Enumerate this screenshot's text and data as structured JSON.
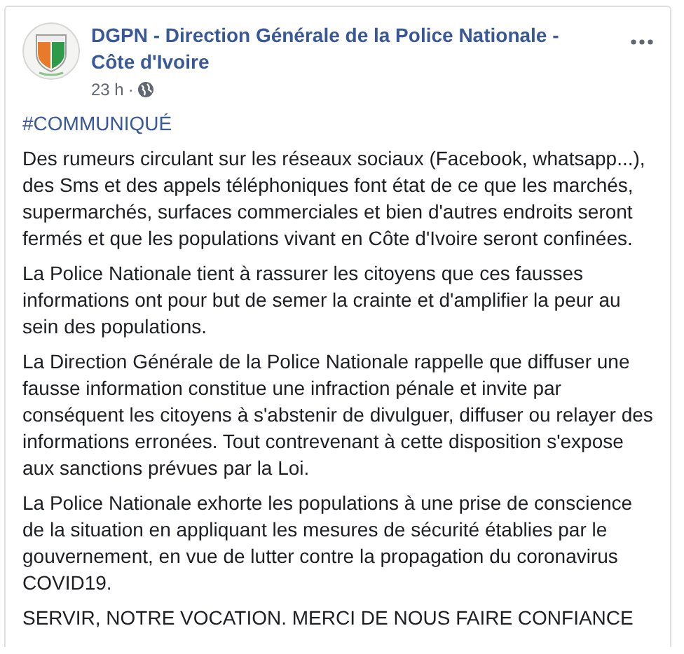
{
  "post": {
    "author": "DGPN - Direction Générale de la Police Nationale - Côte d'Ivoire",
    "time": "23 h",
    "separator": "·",
    "hashtag": "#COMMUNIQUÉ",
    "paragraphs": [
      "Des rumeurs circulant sur les réseaux sociaux (Facebook, whatsapp...), des Sms et des appels téléphoniques font état de ce que les marchés, supermarchés, surfaces commerciales et bien d'autres endroits seront fermés et que les populations vivant en Côte d'Ivoire seront confinées.",
      "La Police Nationale tient à rassurer les citoyens que ces fausses informations ont pour but de semer la crainte et d'amplifier la peur au sein des populations.",
      "La Direction Générale de la Police Nationale rappelle que diffuser une fausse information constitue une infraction pénale et invite par conséquent les citoyens à s'abstenir de divulguer, diffuser ou relayer des informations erronées. Tout contrevenant à cette disposition s'expose aux sanctions prévues par la Loi.",
      "La Police Nationale exhorte les populations à une prise de conscience de la situation en appliquant les mesures de sécurité établies par le gouvernement, en vue de lutter contre la propagation du coronavirus COVID19.",
      "SERVIR, NOTRE VOCATION. MERCI DE NOUS FAIRE CONFIANCE"
    ]
  }
}
